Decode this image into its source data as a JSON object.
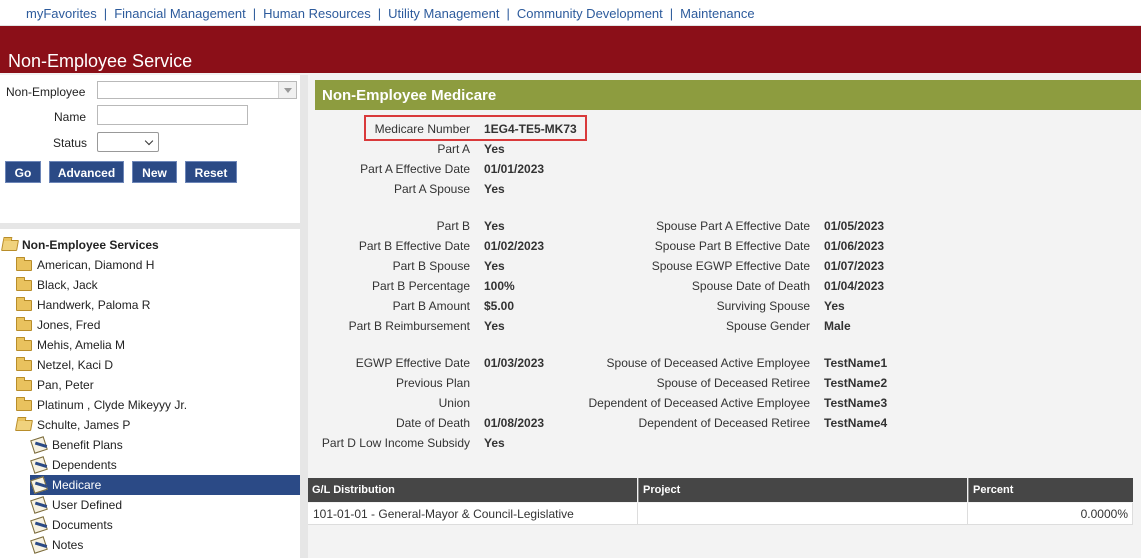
{
  "topnav": {
    "items": [
      "myFavorites",
      "Financial Management",
      "Human Resources",
      "Utility Management",
      "Community Development",
      "Maintenance"
    ]
  },
  "header": {
    "title": "Non-Employee Service"
  },
  "search": {
    "non_employee_label": "Non-Employee",
    "name_label": "Name",
    "status_label": "Status",
    "buttons": {
      "go": "Go",
      "advanced": "Advanced",
      "new": "New",
      "reset": "Reset"
    }
  },
  "tree": {
    "root": "Non-Employee Services",
    "people": [
      "American, Diamond H",
      "Black, Jack",
      "Handwerk, Paloma R",
      "Jones, Fred",
      "Mehis, Amelia M",
      "Netzel, Kaci D",
      "Pan, Peter",
      "Platinum , Clyde Mikeyyy Jr.",
      "Schulte, James P"
    ],
    "children": [
      "Benefit Plans",
      "Dependents",
      "Medicare",
      "User Defined",
      "Documents",
      "Notes"
    ],
    "selected": "Medicare"
  },
  "main": {
    "title": "Non-Employee Medicare",
    "medicare_number": {
      "label": "Medicare Number",
      "value": "1EG4-TE5-MK73"
    },
    "left_fields": [
      {
        "label": "Part A",
        "value": "Yes"
      },
      {
        "label": "Part A Effective Date",
        "value": "01/01/2023"
      },
      {
        "label": "Part A Spouse",
        "value": "Yes"
      },
      {
        "label": "Part B",
        "value": "Yes"
      },
      {
        "label": "Part B Effective Date",
        "value": "01/02/2023"
      },
      {
        "label": "Part B Spouse",
        "value": "Yes"
      },
      {
        "label": "Part B Percentage",
        "value": "100%"
      },
      {
        "label": "Part B Amount",
        "value": "$5.00"
      },
      {
        "label": "Part B Reimbursement",
        "value": "Yes"
      },
      {
        "label": "EGWP Effective Date",
        "value": "01/03/2023"
      },
      {
        "label": "Previous Plan",
        "value": ""
      },
      {
        "label": "Union",
        "value": ""
      },
      {
        "label": "Date of Death",
        "value": "01/08/2023"
      },
      {
        "label": "Part D Low Income Subsidy",
        "value": "Yes"
      }
    ],
    "right_fields": [
      {
        "label": "Spouse Part A Effective Date",
        "value": "01/05/2023"
      },
      {
        "label": "Spouse Part B Effective Date",
        "value": "01/06/2023"
      },
      {
        "label": "Spouse EGWP Effective Date",
        "value": "01/07/2023"
      },
      {
        "label": "Spouse Date of Death",
        "value": "01/04/2023"
      },
      {
        "label": "Surviving Spouse",
        "value": "Yes"
      },
      {
        "label": "Spouse Gender",
        "value": "Male"
      },
      {
        "label": "Spouse of Deceased Active Employee",
        "value": "TestName1"
      },
      {
        "label": "Spouse of Deceased Retiree",
        "value": "TestName2"
      },
      {
        "label": "Dependent of Deceased Active Employee",
        "value": "TestName3"
      },
      {
        "label": "Dependent of Deceased Retiree",
        "value": "TestName4"
      }
    ],
    "gl_table": {
      "headers": [
        "G/L Distribution",
        "Project",
        "Percent"
      ],
      "rows": [
        [
          "101-01-01 - General-Mayor & Council-Legislative",
          "",
          "0.0000%"
        ]
      ]
    }
  },
  "colors": {
    "header": "#8b0f18",
    "section_bar": "#8d9c3f",
    "button": "#2b4a86",
    "link": "#2d5b9c",
    "highlight": "#d9393a"
  }
}
